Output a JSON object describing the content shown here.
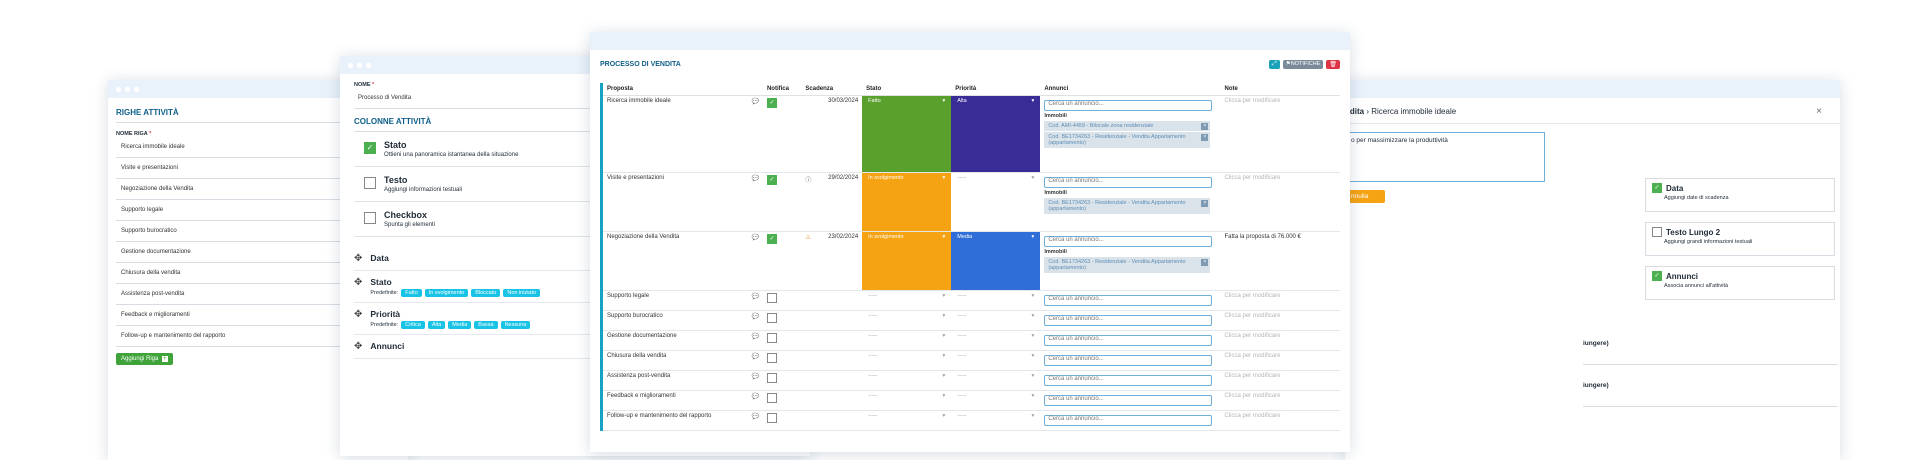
{
  "right_panel": {
    "breadcrumb_prefix": "ndita",
    "breadcrumb_separator": "›",
    "breadcrumb_current": "Ricerca immobile ideale",
    "textarea_value": "o per massimizzare la produttività",
    "cancel_button": "nnulla",
    "close_symbol": "×",
    "cards": [
      {
        "title": "Data",
        "desc": "Aggiungi date di scadenza"
      },
      {
        "title": "Testo Lungo 2",
        "desc": "Aggiungi grandi informazioni testuali"
      },
      {
        "title": "Annunci",
        "desc": "Associa annunci all'attività"
      }
    ],
    "partial_labels": [
      "iungere)",
      "iungere)"
    ]
  },
  "left_panel": {
    "section_title": "RIGHE ATTIVITÀ",
    "field_label": "NOME RIGA",
    "required_mark": "*",
    "rows": [
      "Ricerca immobile ideale",
      "Visite e presentazioni",
      "Negoziazione della Vendita",
      "Supporto legale",
      "Supporto burocratico",
      "Gestione documentazione",
      "Chiusura della vendita",
      "Assistenza post-vendita",
      "Feedback e miglioramenti",
      "Follow-up e mantenimento del rapporto"
    ],
    "add_button": "Aggiungi Riga"
  },
  "middle_panel": {
    "name_label": "NOME",
    "required_mark": "*",
    "name_value": "Processo di Vendita",
    "columns_title": "COLONNE ATTIVITÀ",
    "column_cards": [
      {
        "title": "Stato",
        "desc": "Ottieni una panoramica istantanea della situazione",
        "checked": true
      },
      {
        "title": "Testo",
        "desc": "Aggiungi informazioni testuali",
        "checked": false
      },
      {
        "title": "Checkbox",
        "desc": "Spunta gli elementi",
        "checked": false
      }
    ],
    "active_columns": [
      {
        "title": "Data",
        "predef_label": "",
        "tags": []
      },
      {
        "title": "Stato",
        "predef_label": "Predefinite:",
        "tags": [
          "Fatto",
          "In svolgimento",
          "Bloccato",
          "Non iniziato"
        ]
      },
      {
        "title": "Priorità",
        "predef_label": "Predefinite:",
        "tags": [
          "Critica",
          "Alta",
          "Media",
          "Bassa",
          "Nessuna"
        ]
      },
      {
        "title": "Annunci",
        "predef_label": "",
        "tags": []
      }
    ]
  },
  "main_panel": {
    "title": "PROCESSO DI VENDITA",
    "notify_button": "NOTIFICHE",
    "headers": [
      "Proposta",
      "Notifica",
      "Scadenza",
      "Stato",
      "Priorità",
      "Annunci",
      "Note"
    ],
    "annunci_placeholder": "Cerca un annuncio...",
    "immobili_label": "Immobili",
    "note_placeholder": "Clicca per modificare",
    "rows": [
      {
        "name": "Ricerca immobile ideale",
        "notify": true,
        "date": "30/03/2024",
        "alert": "",
        "status": "Fatto",
        "status_color": "#5aa02c",
        "priority": "Alta",
        "priority_color": "#3a2c96",
        "annunci": [
          "Cod. AMI-4459 - Bilocale zona residenziale",
          "Cod. BE1734263 - Residenziale - Vendita Appartamento (appartamento)"
        ],
        "note": ""
      },
      {
        "name": "Visite e presentazioni",
        "notify": true,
        "date": "29/02/2024",
        "alert": "info",
        "status": "In svolgimento",
        "status_color": "#f5a313",
        "priority": "-----",
        "priority_color": "",
        "annunci": [
          "Cod. BE1734263 - Residenziale - Vendita Appartamento (appartamento)"
        ],
        "note": ""
      },
      {
        "name": "Negoziazione della Vendita",
        "notify": true,
        "date": "23/02/2024",
        "alert": "warn",
        "status": "In svolgimento",
        "status_color": "#f5a313",
        "priority": "Media",
        "priority_color": "#2f6ed8",
        "annunci": [
          "Cod. BE1734263 - Residenziale - Vendita Appartamento (appartamento)"
        ],
        "note": "Fatta la proposta di 76.000 €"
      },
      {
        "name": "Supporto legale",
        "notify": false,
        "date": "",
        "alert": "",
        "status": "-----",
        "status_color": "",
        "priority": "-----",
        "priority_color": "",
        "annunci": [],
        "note": ""
      },
      {
        "name": "Supporto burocratico",
        "notify": false,
        "date": "",
        "alert": "",
        "status": "-----",
        "status_color": "",
        "priority": "-----",
        "priority_color": "",
        "annunci": [],
        "note": ""
      },
      {
        "name": "Gestione documentazione",
        "notify": false,
        "date": "",
        "alert": "",
        "status": "-----",
        "status_color": "",
        "priority": "-----",
        "priority_color": "",
        "annunci": [],
        "note": ""
      },
      {
        "name": "Chiusura della vendita",
        "notify": false,
        "date": "",
        "alert": "",
        "status": "-----",
        "status_color": "",
        "priority": "-----",
        "priority_color": "",
        "annunci": [],
        "note": ""
      },
      {
        "name": "Assistenza post-vendita",
        "notify": false,
        "date": "",
        "alert": "",
        "status": "-----",
        "status_color": "",
        "priority": "-----",
        "priority_color": "",
        "annunci": [],
        "note": ""
      },
      {
        "name": "Feedback e miglioramenti",
        "notify": false,
        "date": "",
        "alert": "",
        "status": "-----",
        "status_color": "",
        "priority": "-----",
        "priority_color": "",
        "annunci": [],
        "note": ""
      },
      {
        "name": "Follow-up e mantenimento del rapporto",
        "notify": false,
        "date": "",
        "alert": "",
        "status": "-----",
        "status_color": "",
        "priority": "-----",
        "priority_color": "",
        "annunci": [],
        "note": ""
      }
    ]
  }
}
